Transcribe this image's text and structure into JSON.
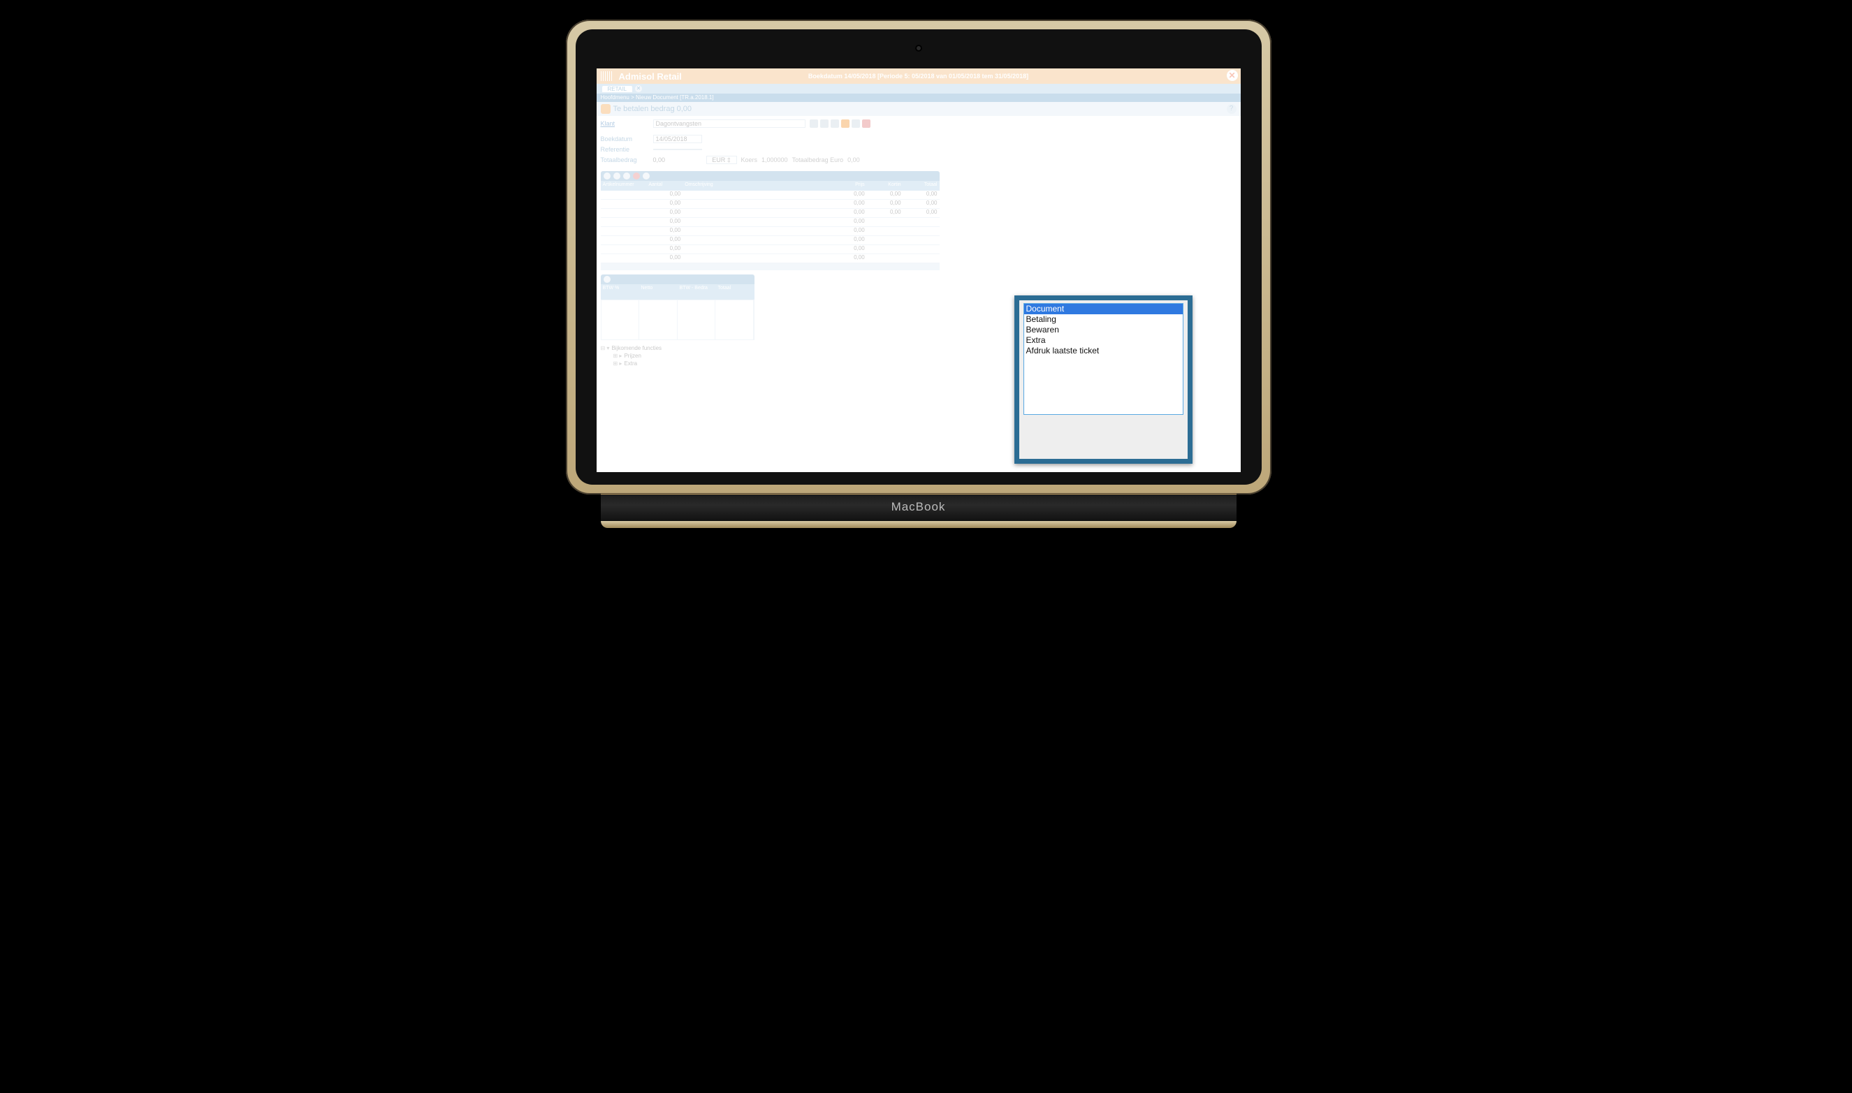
{
  "laptop_label": "MacBook",
  "titlebar": {
    "app_name": "Admisol Retail",
    "info": "Boekdatum 14/05/2018 [Periode 5: 05/2018 van 01/05/2018 tem 31/05/2018]"
  },
  "tabstrip": {
    "tab": "RETAIL"
  },
  "breadcrumb": "Hoofdmenu  >  Nieuw Document [TR.a.2018.1]",
  "subhead": "Te betalen bedrag  0,00",
  "form": {
    "klant_label": "Klant",
    "klant_value": "Dagontvangsten",
    "boekdatum_label": "Boekdatum",
    "boekdatum_value": "14/05/2018",
    "ref_label": "Referentie",
    "totaal_label": "Totaalbedrag",
    "totaal_value": "0,00",
    "currency": "EUR",
    "koers_label": "Koers",
    "koers_value": "1,000000",
    "totaal_eur_label": "Totaalbedrag Euro",
    "totaal_eur_value": "0,00"
  },
  "grid": {
    "headers": [
      "Artikelnummer",
      "Aantal",
      "Omschrijving",
      "Prijs",
      "Kortin",
      "Totaal"
    ],
    "rows": [
      {
        "aantal": "0,00",
        "prijs": "0,00",
        "kort": "0,00",
        "tot": "0,00"
      },
      {
        "aantal": "0,00",
        "prijs": "0,00",
        "kort": "0,00",
        "tot": "0,00"
      },
      {
        "aantal": "0,00",
        "prijs": "0,00",
        "kort": "0,00",
        "tot": "0,00"
      },
      {
        "aantal": "0,00",
        "prijs": "0,00",
        "kort": "",
        "tot": ""
      },
      {
        "aantal": "0,00",
        "prijs": "0,00",
        "kort": "",
        "tot": ""
      },
      {
        "aantal": "0,00",
        "prijs": "0,00",
        "kort": "",
        "tot": ""
      },
      {
        "aantal": "0,00",
        "prijs": "0,00",
        "kort": "",
        "tot": ""
      },
      {
        "aantal": "0,00",
        "prijs": "0,00",
        "kort": "",
        "tot": ""
      }
    ]
  },
  "btw": {
    "headers": [
      "BTW %",
      "Netto",
      "BTW - Bedra",
      "Totaal"
    ]
  },
  "tree": {
    "root": "Bijkomende functies",
    "n1": "Prijzen",
    "n2": "Extra"
  },
  "popup": {
    "items": [
      "Document",
      "Betaling",
      "Bewaren",
      "Extra",
      "Afdruk laatste ticket"
    ]
  }
}
